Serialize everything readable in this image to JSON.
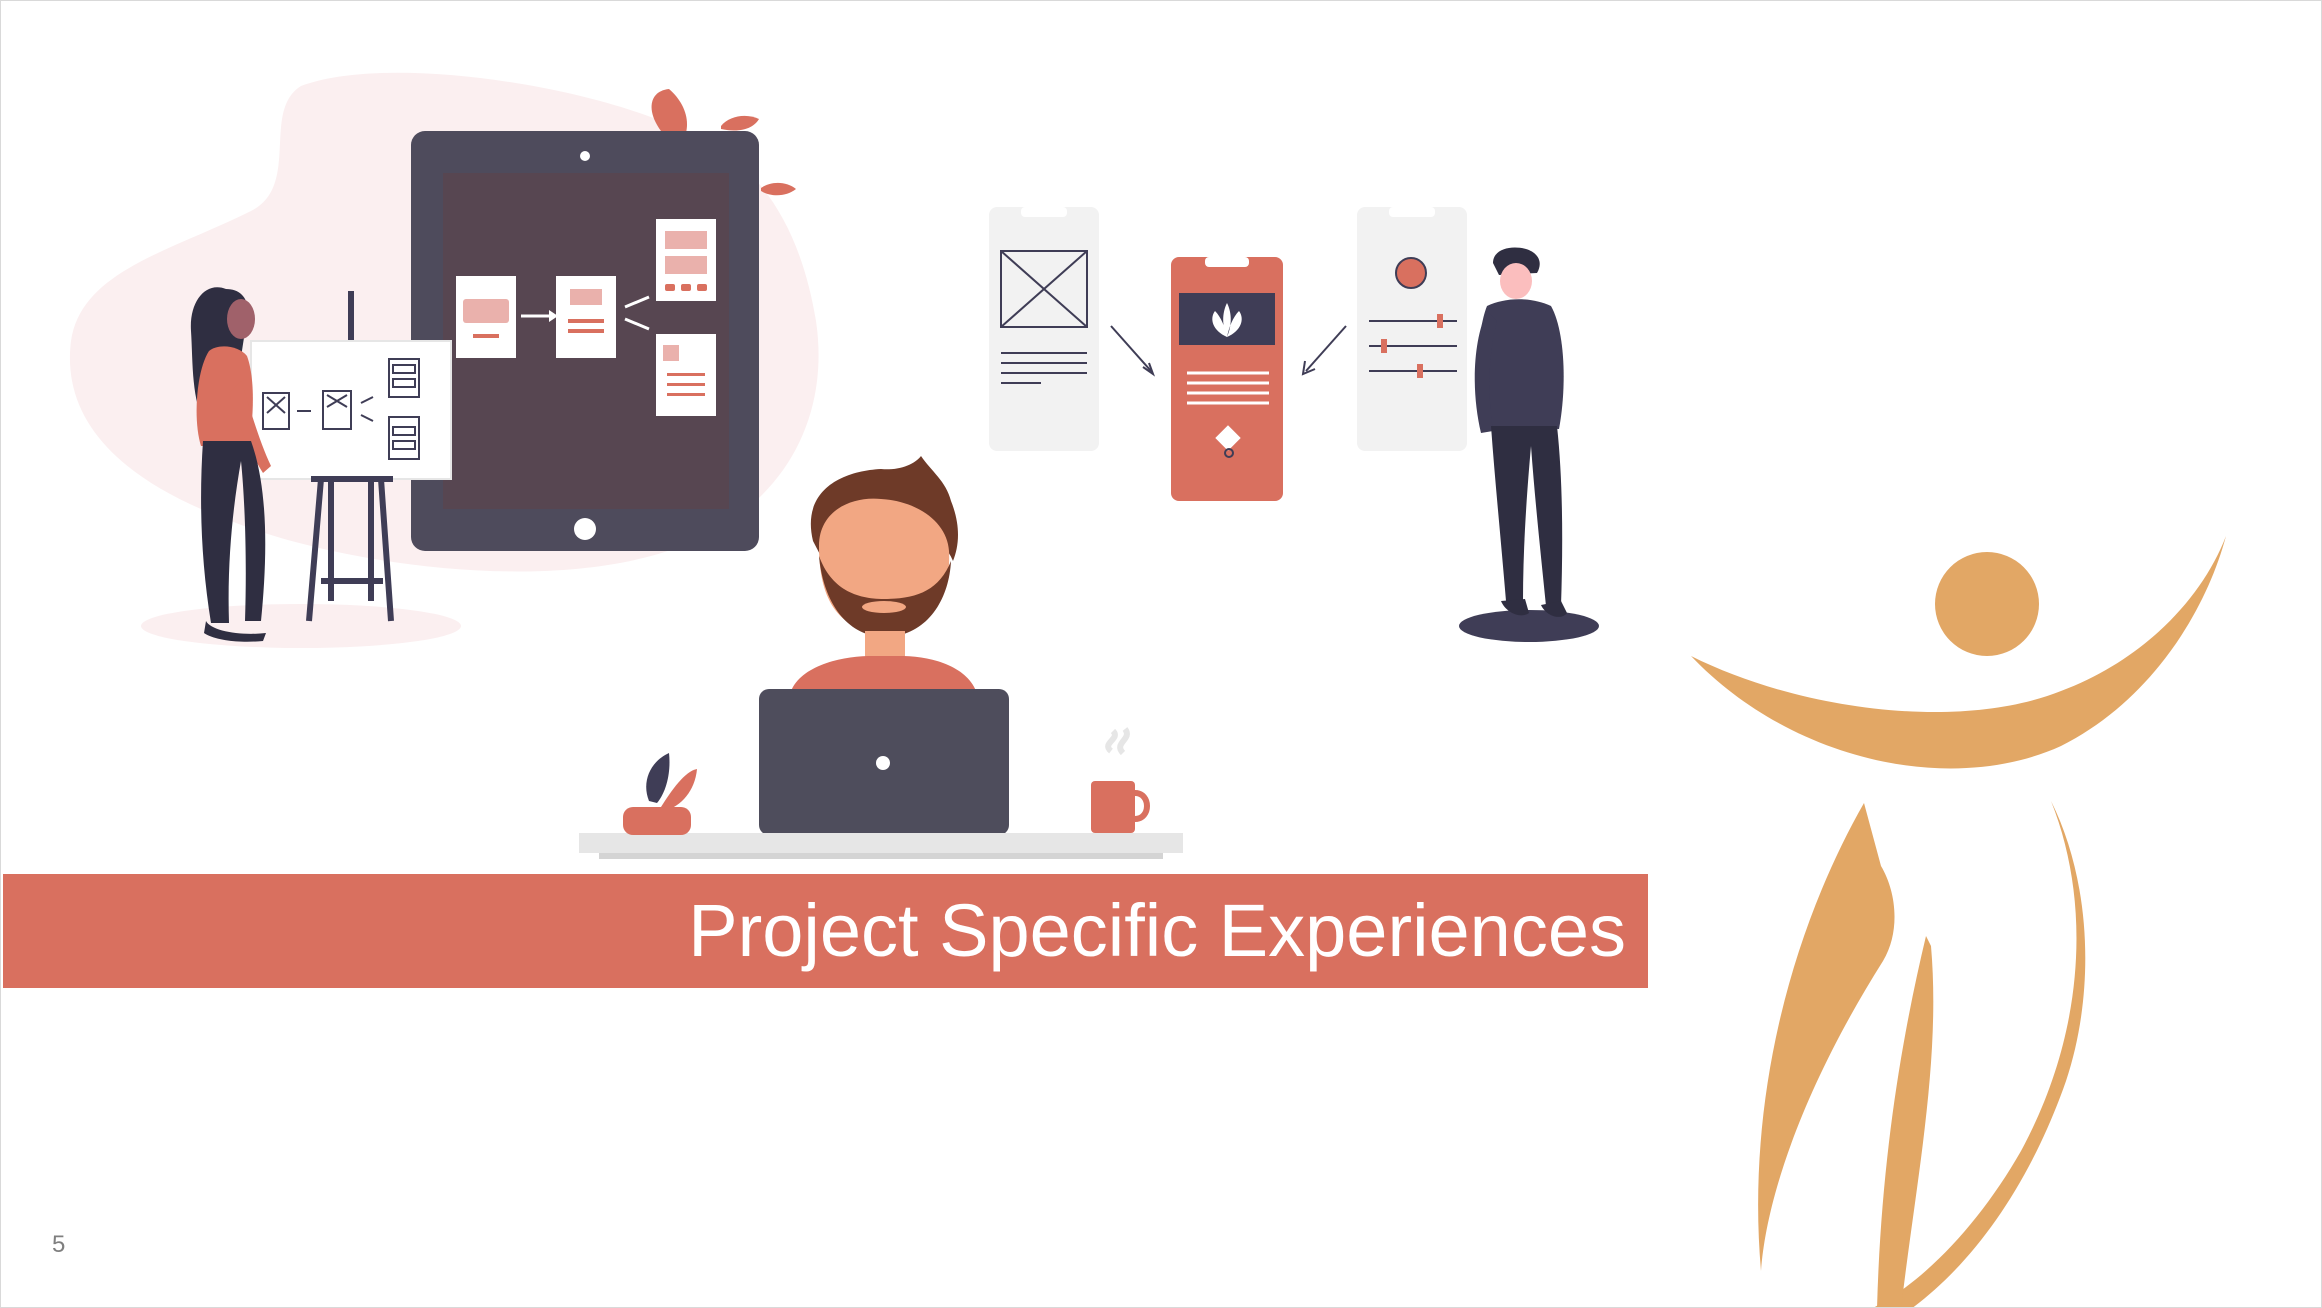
{
  "slide": {
    "title": "Project Specific Experiences",
    "page_number": "5"
  },
  "colors": {
    "accent_band": "#d9705f",
    "logo_gold": "#e2a765",
    "device_dark": "#3f3d56",
    "blush_blob": "#fbeff0",
    "wireframe_gray": "#f2f2f2"
  },
  "illustrations": {
    "left": "woman-presenting-flowchart-on-tablet",
    "center": "man-with-laptop-at-desk",
    "right": "man-viewing-mobile-wireframes",
    "logo": "gold-figure-logo"
  }
}
